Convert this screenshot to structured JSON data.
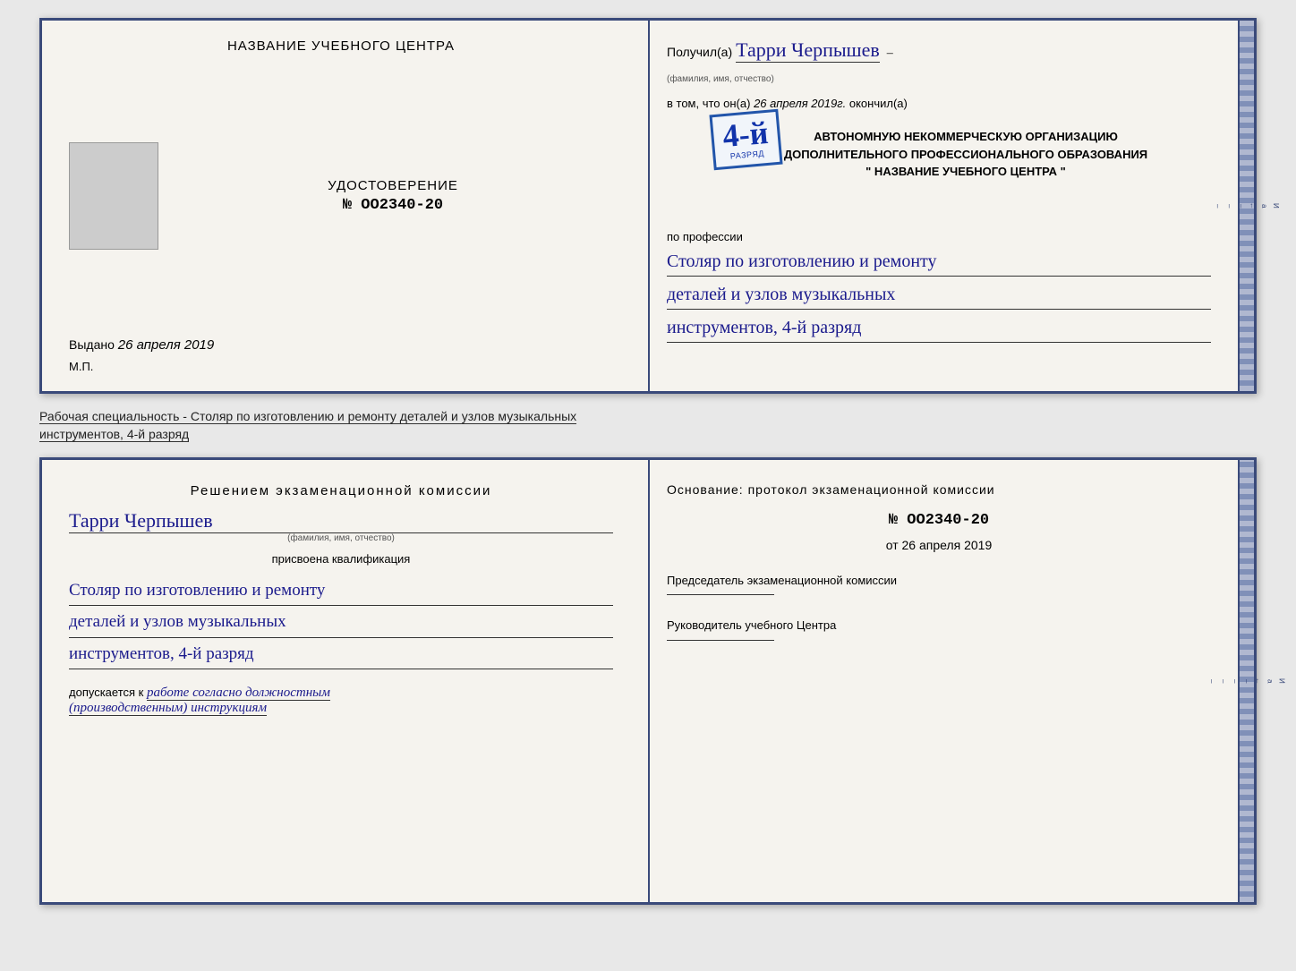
{
  "top_doc": {
    "left": {
      "center_name": "НАЗВАНИЕ УЧЕБНОГО ЦЕНТРА",
      "cert_label": "УДОСТОВЕРЕНИЕ",
      "cert_number": "№ OO2340-20",
      "issued_label": "Выдано",
      "issued_date": "26 апреля 2019",
      "mp_label": "М.П."
    },
    "right": {
      "received_label": "Получил(а)",
      "recipient_name": "Тарри Черпышев",
      "fio_subtitle": "(фамилия, имя, отчество)",
      "dash": "–",
      "in_that_label": "в том, что он(а)",
      "completed_date": "26 апреля 2019г.",
      "completed_label": "окончил(а)",
      "stamp_number": "4-й",
      "stamp_line1": "АВТОНОМНУЮ НЕКОММЕРЧЕСКУЮ ОРГАНИЗАЦИЮ",
      "stamp_line2": "ДОПОЛНИТЕЛЬНОГО ПРОФЕССИОНАЛЬНОГО ОБРАЗОВАНИЯ",
      "stamp_line3": "\" НАЗВАНИЕ УЧЕБНОГО ЦЕНТРА \"",
      "profession_label": "по профессии",
      "profession_line1": "Столяр по изготовлению и ремонту",
      "profession_line2": "деталей и узлов музыкальных",
      "profession_line3": "инструментов, 4-й разряд"
    }
  },
  "subtitle": {
    "text1": "Рабочая специальность - Столяр по изготовлению и ремонту деталей и узлов музыкальных",
    "text2": "инструментов, 4-й разряд"
  },
  "bottom_doc": {
    "left": {
      "decision_title": "Решением  экзаменационной  комиссии",
      "person_name": "Тарри Черпышев",
      "fio_subtitle": "(фамилия, имя, отчество)",
      "assigned_label": "присвоена квалификация",
      "qual_line1": "Столяр по изготовлению и ремонту",
      "qual_line2": "деталей и узлов музыкальных",
      "qual_line3": "инструментов, 4-й разряд",
      "allowed_label": "допускается к",
      "allowed_text": "работе согласно должностным",
      "allowed_text2": "(производственным) инструкциям"
    },
    "right": {
      "basis_label": "Основание:  протокол  экзаменационной  комиссии",
      "protocol_number": "№  OO2340-20",
      "protocol_date_prefix": "от",
      "protocol_date": "26 апреля 2019",
      "chairman_label": "Председатель экзаменационной комиссии",
      "director_label": "Руководитель учебного Центра"
    },
    "right_strip": {
      "labels": [
        "И",
        "а",
        "←",
        "–",
        "–",
        "–",
        "–"
      ]
    }
  }
}
